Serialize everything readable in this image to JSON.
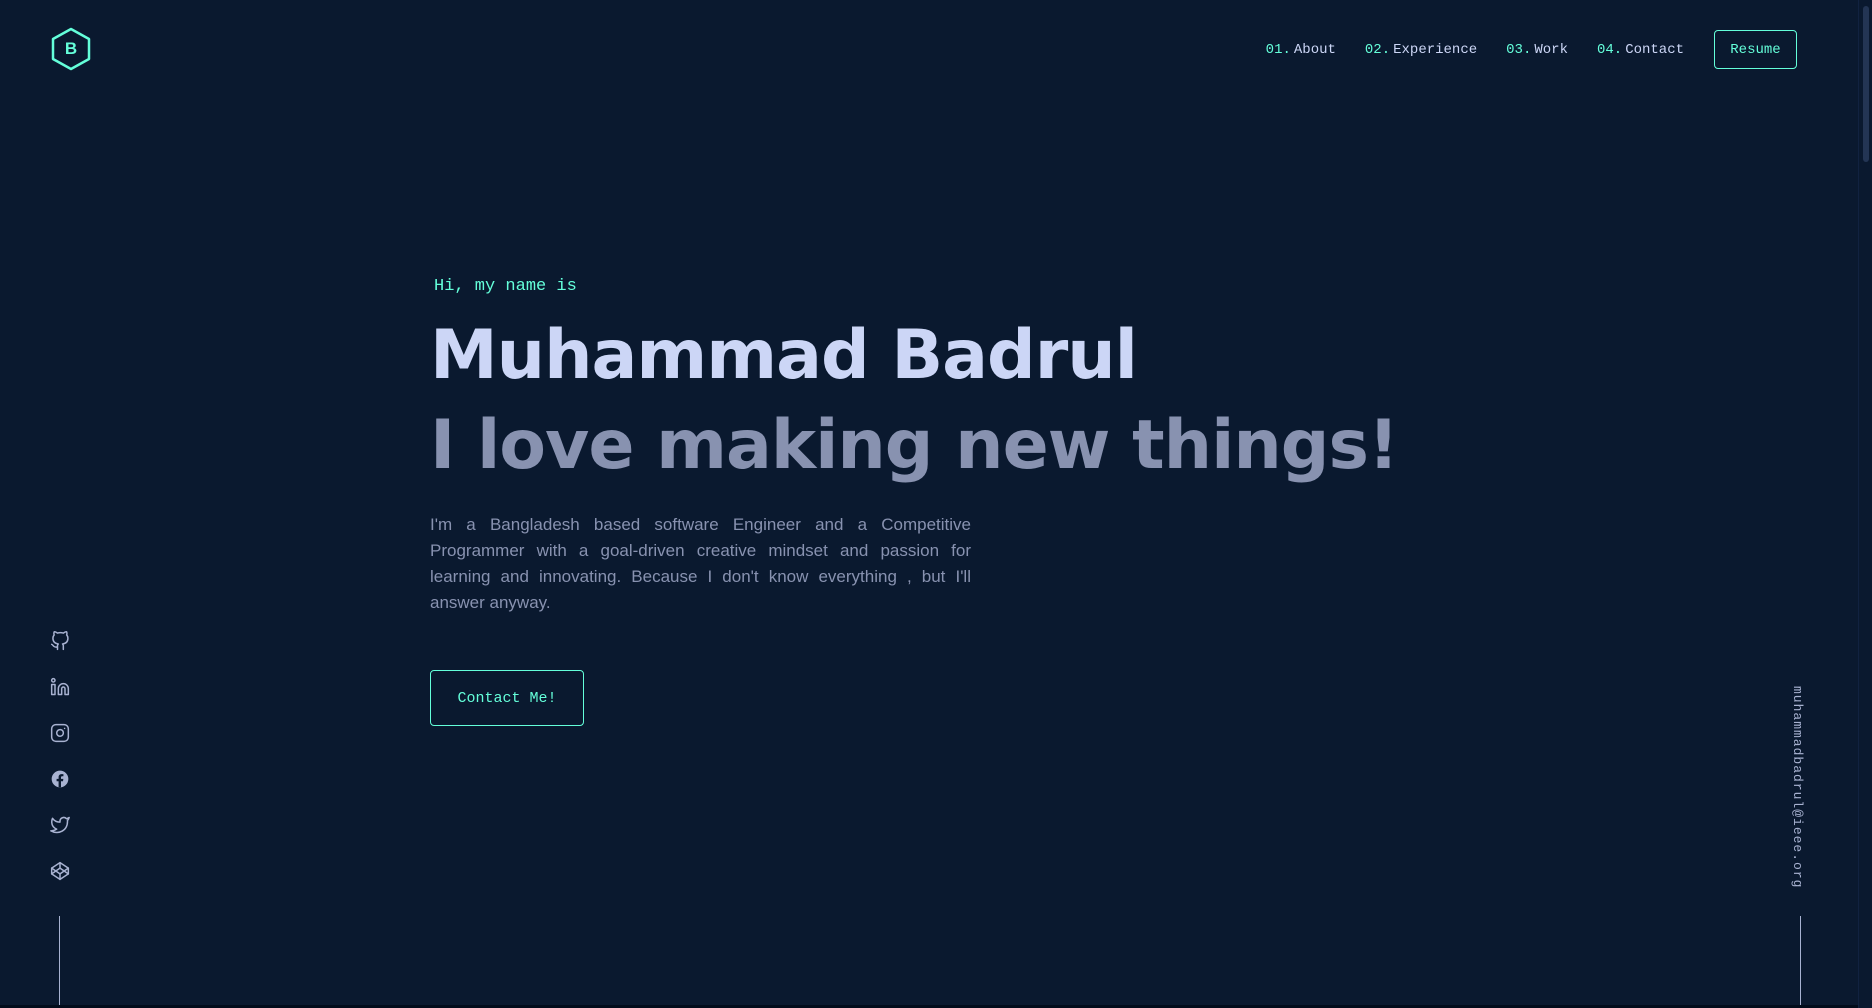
{
  "brand": {
    "logo_letter": "B",
    "accent_color": "#64ffda",
    "background_color": "#0a192f"
  },
  "nav": {
    "items": [
      {
        "num": "01.",
        "label": "About"
      },
      {
        "num": "02.",
        "label": "Experience"
      },
      {
        "num": "03.",
        "label": "Work"
      },
      {
        "num": "04.",
        "label": "Contact"
      }
    ],
    "resume_label": "Resume"
  },
  "hero": {
    "greeting": "Hi, my name is",
    "name": "Muhammad Badrul",
    "tagline": "I love making new things!",
    "bio": "I'm a Bangladesh based software Engineer and a Competitive Programmer with a goal-driven creative mindset and passion for learning and innovating. Because I don't know everything , but I'll answer anyway.",
    "cta_label": "Contact Me!"
  },
  "social": {
    "icons": [
      "github-icon",
      "linkedin-icon",
      "instagram-icon",
      "facebook-icon",
      "twitter-icon",
      "codepen-icon"
    ]
  },
  "email": "muhammadbadrul@ieee.org"
}
